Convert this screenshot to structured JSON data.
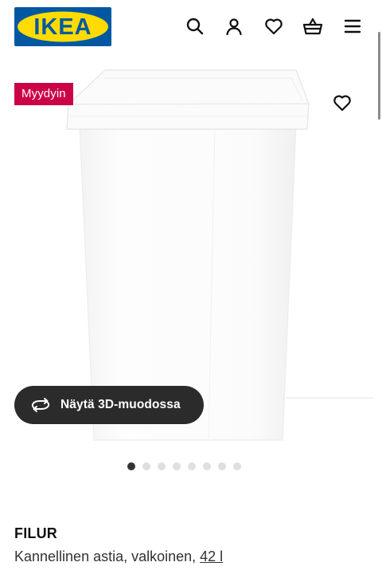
{
  "brand": {
    "logo_text": "IKEA",
    "colors": {
      "blue": "#0058a3",
      "yellow": "#ffdb00",
      "badge": "#cc0046",
      "pill": "#2b2b2b"
    }
  },
  "header": {
    "icons": [
      "search-icon",
      "user-icon",
      "heart-icon",
      "basket-icon",
      "menu-icon"
    ]
  },
  "gallery": {
    "badge": "Myydyin",
    "view3d_label": "Näytä 3D-muodossa",
    "dots": {
      "count": 8,
      "active_index": 0
    }
  },
  "product": {
    "name": "FILUR",
    "description_prefix": "Kannellinen astia, valkoinen, ",
    "size_link": "42 l"
  }
}
